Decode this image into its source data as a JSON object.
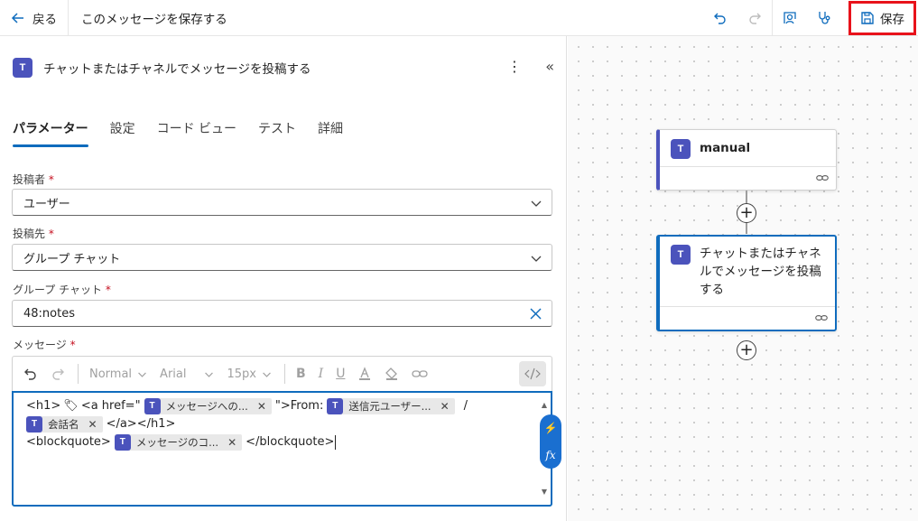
{
  "topbar": {
    "back_label": "戻る",
    "title": "このメッセージを保存する",
    "save_label": "保存",
    "icons": [
      "back-arrow-icon",
      "undo-icon",
      "redo-icon",
      "flow-checker-icon",
      "stethoscope-icon",
      "save-icon"
    ]
  },
  "panel": {
    "title": "チャットまたはチャネルでメッセージを投稿する",
    "tabs": [
      "パラメーター",
      "設定",
      "コード ビュー",
      "テスト",
      "詳細"
    ],
    "active_tab": "パラメーター",
    "fields": {
      "poster": {
        "label": "投稿者",
        "required_mark": "*",
        "value": "ユーザー"
      },
      "post_in": {
        "label": "投稿先",
        "required_mark": "*",
        "value": "グループ チャット"
      },
      "group_chat": {
        "label": "グループ チャット",
        "required_mark": "*",
        "value": "48:notes"
      },
      "message": {
        "label": "メッセージ",
        "required_mark": "*"
      }
    },
    "toolbar": {
      "style": "Normal",
      "font": "Arial",
      "size": "15px"
    },
    "editor": {
      "line1_a": "<h1>",
      "line1_b": "<a href=\"",
      "token1": "メッセージへの...",
      "line1_c": "\">From:",
      "token2": "送信元ユーザー...",
      "line1_d": "/",
      "token3": "会話名",
      "line2_a": "</a></h1>",
      "line3_a": "<blockquote>",
      "token4": "メッセージのコ...",
      "line3_b": "</blockquote>"
    }
  },
  "canvas": {
    "node1_title": "manual",
    "node2_title": "チャットまたはチャネルでメッセージを投稿する"
  },
  "colors": {
    "accent": "#0f6cbd",
    "teams": "#4b53bc",
    "highlight": "#e8121b"
  }
}
